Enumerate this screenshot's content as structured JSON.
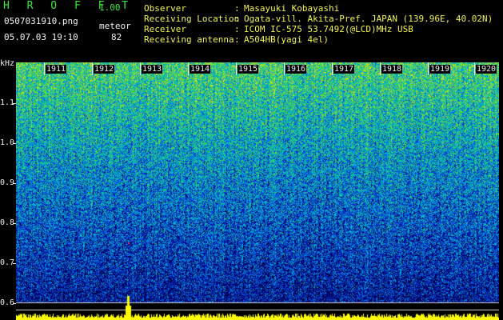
{
  "app": {
    "name": "H R O F F T",
    "version": "1.00"
  },
  "file": {
    "name": "0507031910.png",
    "datetime": "05.07.03 19:10"
  },
  "meteor": {
    "label": "meteor",
    "count": "82"
  },
  "info": [
    {
      "key": "Observer",
      "sep": ":",
      "value": "Masayuki Kobayashi"
    },
    {
      "key": "Receiving Location",
      "sep": ":",
      "value": "Ogata-vill. Akita-Pref. JAPAN (139.96E, 40.02N)"
    },
    {
      "key": "Receiver",
      "sep": ":",
      "value": "ICOM IC-575 53.7492(@LCD)MHz USB"
    },
    {
      "key": "Receiving antenna",
      "sep": ":",
      "value": "A504HB(yagi 4el)"
    }
  ],
  "axis": {
    "unit": "kHz",
    "freq_labels": [
      "1.1",
      "1.0",
      "0.9",
      "0.8",
      "0.7",
      "0.6"
    ],
    "time_labels": [
      "1911",
      "1912",
      "1913",
      "1914",
      "1915",
      "1916",
      "1917",
      "1918",
      "1919",
      "1920"
    ]
  },
  "colors": {
    "title": "#39e839",
    "info": "#f2f24a",
    "text": "#f0f0f0",
    "signal": "#ffff00"
  }
}
